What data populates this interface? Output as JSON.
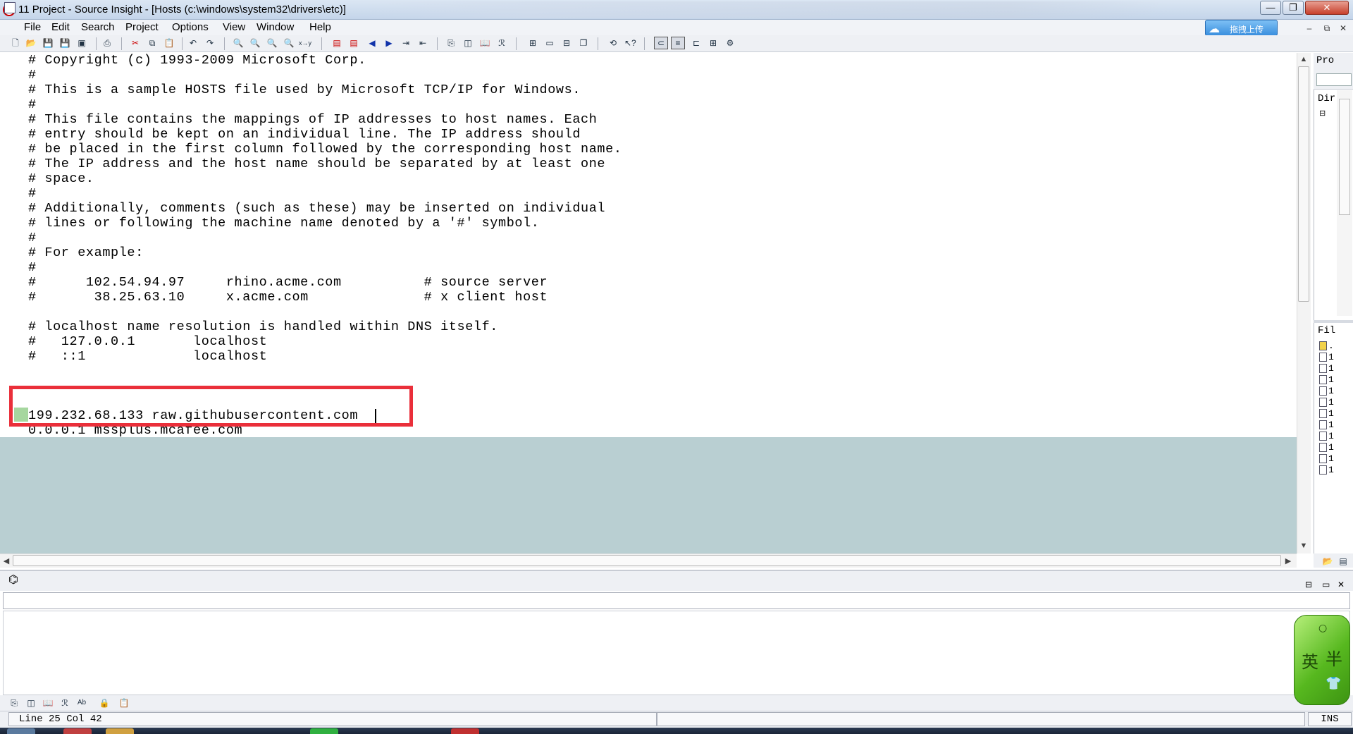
{
  "window": {
    "title": "11 Project - Source Insight - [Hosts (c:\\windows\\system32\\drivers\\etc)]",
    "min_label": "—",
    "max_label": "❐",
    "close_label": "✕"
  },
  "menu": {
    "items": [
      "File",
      "Edit",
      "Search",
      "Project",
      "Options",
      "View",
      "Window",
      "Help"
    ]
  },
  "upload": {
    "label": "拖拽上传",
    "icon": "cloud-upload-icon"
  },
  "mdi": {
    "min_label": "–",
    "restore_label": "⧉",
    "close_label": "✕"
  },
  "editor": {
    "lines": [
      "# Copyright (c) 1993-2009 Microsoft Corp.",
      "#",
      "# This is a sample HOSTS file used by Microsoft TCP/IP for Windows.",
      "#",
      "# This file contains the mappings of IP addresses to host names. Each",
      "# entry should be kept on an individual line. The IP address should",
      "# be placed in the first column followed by the corresponding host name.",
      "# The IP address and the host name should be separated by at least one",
      "# space.",
      "#",
      "# Additionally, comments (such as these) may be inserted on individual",
      "# lines or following the machine name denoted by a '#' symbol.",
      "#",
      "# For example:",
      "#",
      "#      102.54.94.97     rhino.acme.com          # source server",
      "#       38.25.63.10     x.acme.com              # x client host",
      "",
      "# localhost name resolution is handled within DNS itself.",
      "#   127.0.0.1       localhost",
      "#   ::1             localhost",
      "",
      "",
      "",
      "199.232.68.133 raw.githubusercontent.com ",
      "0.0.0.1 mssplus.mcafee.com"
    ]
  },
  "right_panel": {
    "top_header": "Pro",
    "dir_header": "Dir",
    "file_header": "Fil",
    "files": [
      ".",
      "1",
      "1",
      "1",
      "1",
      "1",
      "1",
      "1",
      "1",
      "1",
      "1",
      "1"
    ]
  },
  "ime": {
    "char1": "英",
    "char2": "半"
  },
  "status": {
    "position": "Line 25  Col 42",
    "mode": "INS"
  },
  "colors": {
    "highlight": "#ea2f3a",
    "eof_area": "#b9cfd2",
    "gutter_mark": "#a6d79f"
  }
}
